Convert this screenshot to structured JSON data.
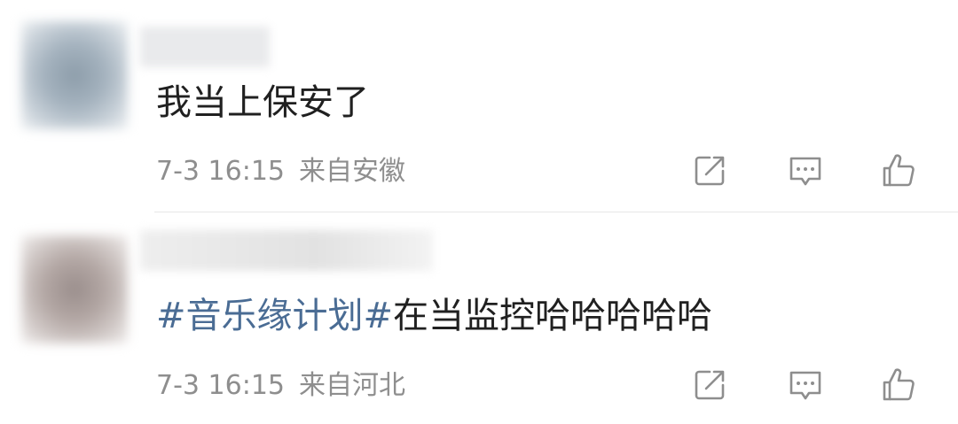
{
  "comments": [
    {
      "text": "我当上保安了",
      "time": "7-3 16:15",
      "location": "来自安徽"
    },
    {
      "hashtag": "#音乐缘计划#",
      "text": "在当监控哈哈哈哈哈",
      "time": "7-3 16:15",
      "location": "来自河北"
    }
  ],
  "icons": {
    "share": "share-icon",
    "comment": "comment-icon",
    "like": "thumbs-up-icon"
  },
  "colors": {
    "hashtag": "#4a6c94",
    "meta": "#8e8e8e",
    "text": "#202020"
  }
}
